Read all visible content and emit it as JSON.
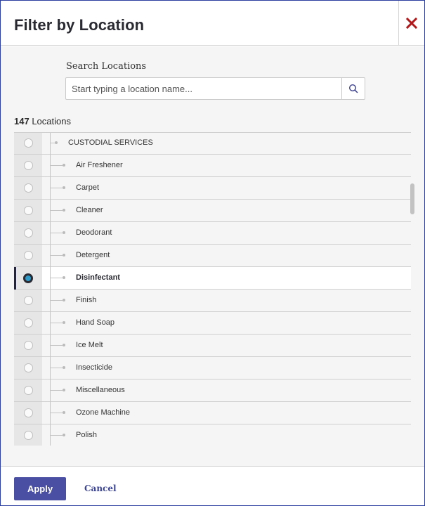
{
  "dialog": {
    "title": "Filter by Location",
    "close_icon": "close-x-icon",
    "close_color": "#b1181b"
  },
  "search": {
    "label": "Search Locations",
    "placeholder": "Start typing a location name...",
    "value": "",
    "button_icon": "search-icon"
  },
  "count": {
    "number": "147",
    "label": " Locations"
  },
  "list": {
    "items": [
      {
        "label": "CUSTODIAL SERVICES",
        "level": 0,
        "selected": false
      },
      {
        "label": "Air Freshener",
        "level": 1,
        "selected": false
      },
      {
        "label": "Carpet",
        "level": 1,
        "selected": false
      },
      {
        "label": "Cleaner",
        "level": 1,
        "selected": false
      },
      {
        "label": "Deodorant",
        "level": 1,
        "selected": false
      },
      {
        "label": "Detergent",
        "level": 1,
        "selected": false
      },
      {
        "label": "Disinfectant",
        "level": 1,
        "selected": true
      },
      {
        "label": "Finish",
        "level": 1,
        "selected": false
      },
      {
        "label": "Hand Soap",
        "level": 1,
        "selected": false
      },
      {
        "label": "Ice Melt",
        "level": 1,
        "selected": false
      },
      {
        "label": "Insecticide",
        "level": 1,
        "selected": false
      },
      {
        "label": "Miscellaneous",
        "level": 1,
        "selected": false
      },
      {
        "label": "Ozone Machine",
        "level": 1,
        "selected": false
      },
      {
        "label": "Polish",
        "level": 1,
        "selected": false
      }
    ]
  },
  "footer": {
    "apply_label": "Apply",
    "cancel_label": "Cancel"
  },
  "colors": {
    "accent": "#4a4fa3",
    "selected_radio": "#2e9ac8",
    "border": "#2c3fa0"
  }
}
